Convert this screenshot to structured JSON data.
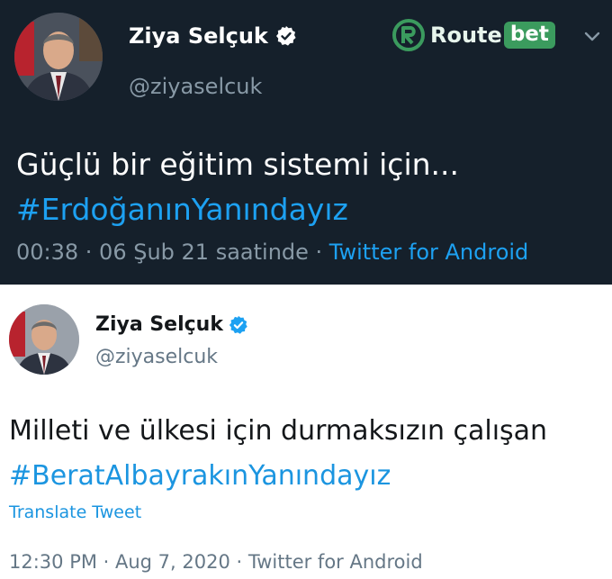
{
  "watermark": {
    "brand_prefix": "Route",
    "brand_suffix": "bet",
    "color": "#3b9b5e"
  },
  "tweet_dark": {
    "theme": "dark",
    "background": "#15202b",
    "author_name": "Ziya Selçuk",
    "handle": "@ziyaselcuk",
    "verified_icon": "verified-badge-icon",
    "text": "Güçlü bir eğitim sistemi için...",
    "hashtag": "#ErdoğanınYanındayız",
    "timestamp": "00:38 · 06 Şub 21 saatinde · ",
    "source": "Twitter for Android",
    "menu_icon": "chevron-down-icon"
  },
  "tweet_light": {
    "theme": "light",
    "background": "#ffffff",
    "author_name": "Ziya Selçuk",
    "handle": "@ziyaselcuk",
    "verified_icon": "verified-badge-icon",
    "text": "Milleti ve ülkesi için durmaksızın çalışan",
    "hashtag": "#BeratAlbayrakınYanındayız",
    "translate_label": "Translate Tweet",
    "timestamp": "12:30 PM · Aug 7, 2020 · Twitter for Android"
  },
  "colors": {
    "link_blue": "#1da1f2",
    "verified_blue": "#1da1f2",
    "muted_dark": "#8899a6",
    "muted_light": "#657786"
  }
}
